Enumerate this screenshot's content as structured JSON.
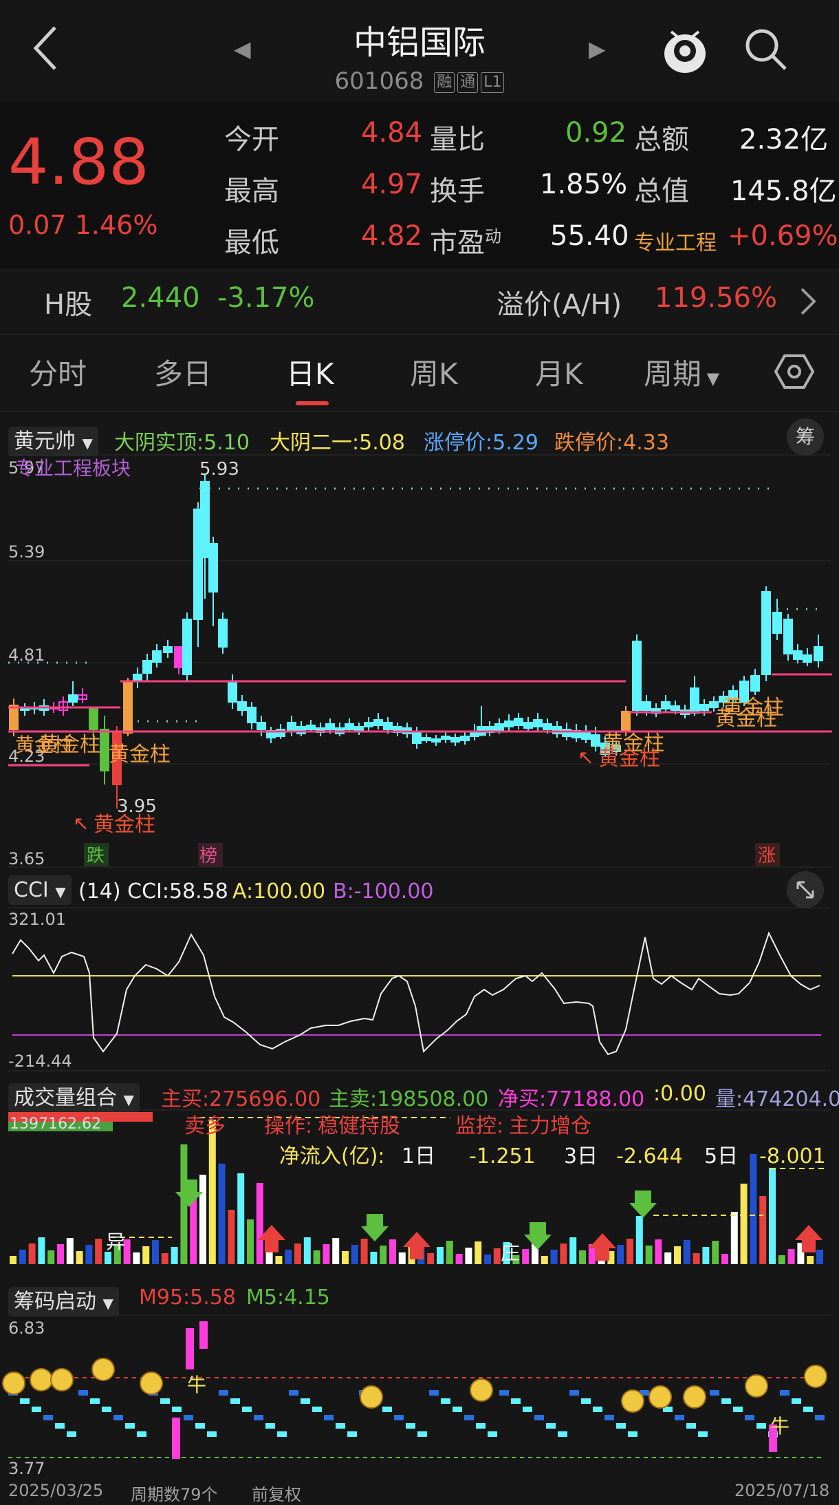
{
  "header": {
    "title": "中铝国际",
    "code": "601068",
    "badges": [
      "融",
      "通",
      "L1"
    ]
  },
  "quote": {
    "price": "4.88",
    "change": "0.07",
    "change_pct": "1.46%",
    "open_label": "今开",
    "open": "4.84",
    "high_label": "最高",
    "high": "4.97",
    "low_label": "最低",
    "low": "4.82",
    "vr_label": "量比",
    "vr": "0.92",
    "turnover_label": "换手",
    "turnover": "1.85%",
    "pe_label": "市盈",
    "pe_sup": "动",
    "pe": "55.40",
    "amount_label": "总额",
    "amount": "2.32亿",
    "mcap_label": "总值",
    "mcap": "145.8亿",
    "sector": "专业工程",
    "sector_pct": "+0.69%"
  },
  "hshare": {
    "label": "H股",
    "price": "2.440",
    "pct": "-3.17%",
    "premium_label": "溢价(A/H)",
    "premium": "119.56%"
  },
  "tabs": [
    "分时",
    "多日",
    "日K",
    "周K",
    "月K",
    "周期"
  ],
  "main_indicator": {
    "name": "黄元帅",
    "daying_top_label": "大阴实顶:",
    "daying_top": "5.10",
    "daying_two_label": "大阴二一:",
    "daying_two": "5.08",
    "limit_up_label": "涨停价:",
    "limit_up": "5.29",
    "limit_down_label": "跌停价:",
    "limit_down": "4.33",
    "chip_label": "筹",
    "board_tag": "专业工程板块",
    "axis": [
      "5.97",
      "5.39",
      "4.81",
      "4.23",
      "3.65"
    ],
    "peak_label": "5.93",
    "trough_label": "3.95",
    "golden_labels": [
      "黄金柱",
      "黄金柱",
      "黄金柱",
      "黄金柱",
      "黄金柱"
    ],
    "huangjing_labels": [
      "黄金柱",
      "黄金柱"
    ],
    "event_tags": [
      "跌",
      "榜",
      "涨"
    ]
  },
  "cci": {
    "name": "CCI",
    "period": "(14)",
    "cci_label": "CCI:",
    "cci": "58.58",
    "a_label": "A:",
    "a": "100.00",
    "b_label": "B:",
    "b": "-100.00",
    "top": "321.01",
    "bottom": "-214.44"
  },
  "volume": {
    "name": "成交量组合",
    "buy_label": "主买:",
    "buy": "275696.00",
    "sell_label": "主卖:",
    "sell": "198508.00",
    "net_label": "净买:",
    "net": "77188.00",
    "extra_label": ":",
    "extra": "0.00",
    "vol_label": "量:",
    "vol": "474204.0",
    "max": "1397162.62",
    "tag_left": "卖多",
    "op_label": "操作:",
    "op": "稳健持股",
    "monitor_label": "监控:",
    "monitor": "主力增仓",
    "inflow_label": "净流入(亿):",
    "d1_label": "1日",
    "d1": "-1.251",
    "d3_label": "3日",
    "d3": "-2.644",
    "d5_label": "5日",
    "d5": "-8.001",
    "marks": [
      "异",
      "庄"
    ]
  },
  "chips": {
    "name": "筹码启动",
    "m95_label": "M95:",
    "m95": "5.58",
    "m5_label": "M5:",
    "m5": "4.15",
    "top": "6.83",
    "bottom": "3.77",
    "bull_mark": "牛"
  },
  "footer": {
    "start": "2025/03/25",
    "period_count": "周期数79个",
    "adjust": "前复权",
    "end": "2025/07/18"
  },
  "colors": {
    "up": "#e8403c",
    "down": "#5cbf3e",
    "candle_up": "#ff3cdc",
    "candle_down": "#5ff3ff"
  }
}
